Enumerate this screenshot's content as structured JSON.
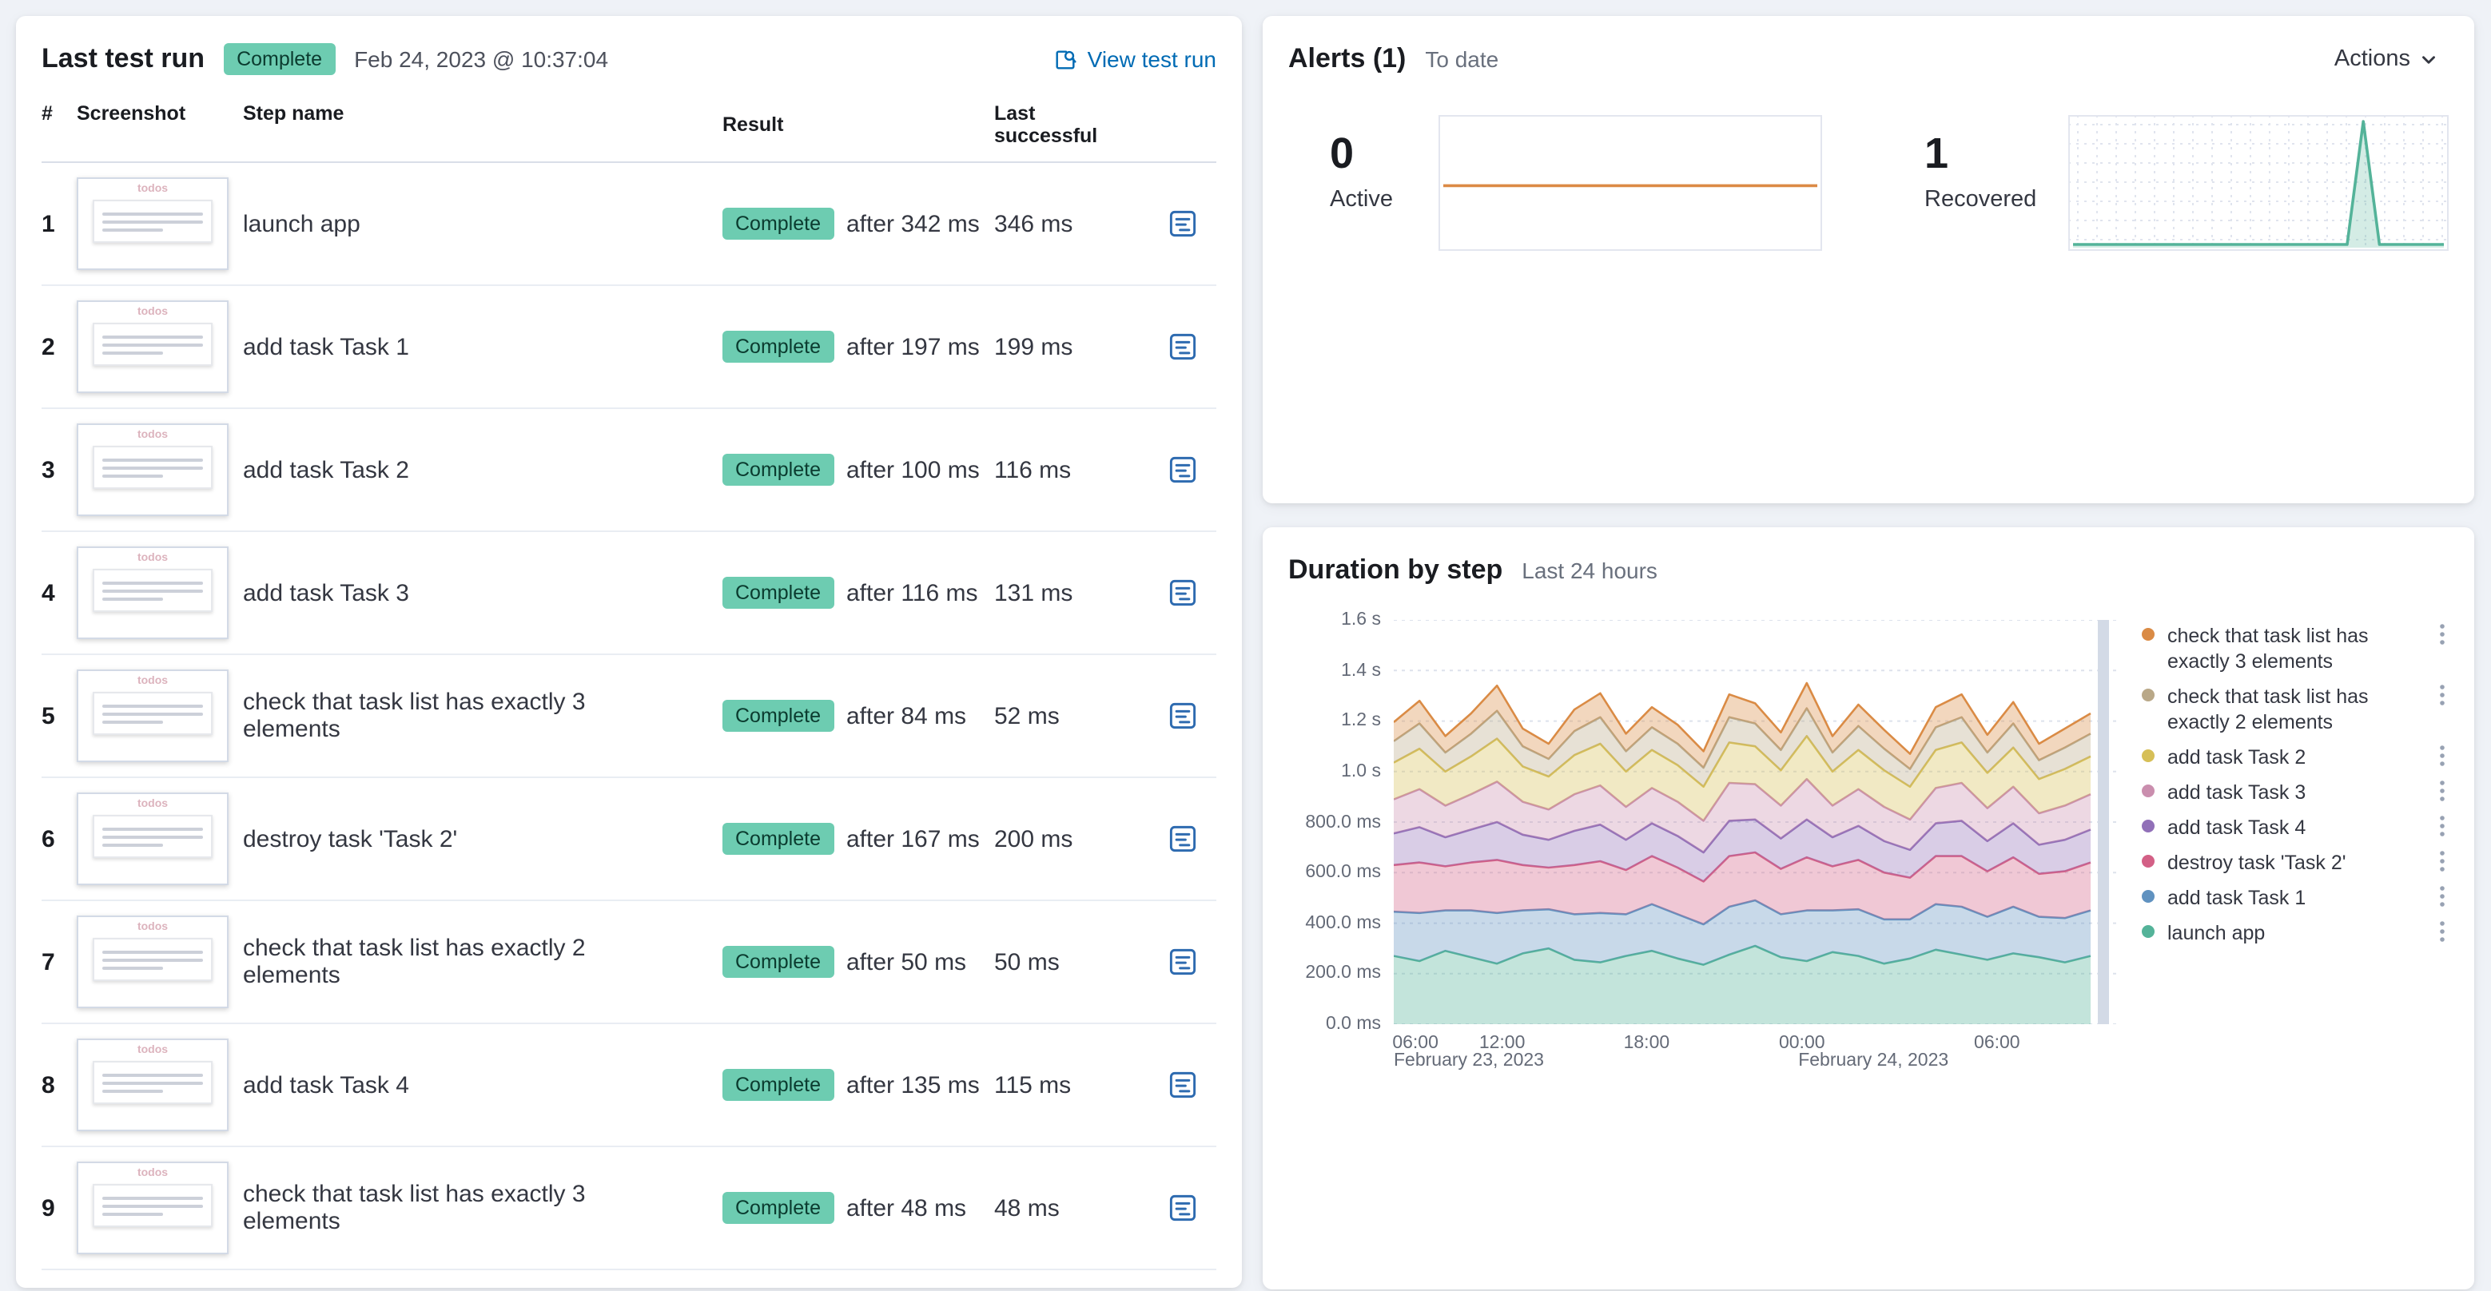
{
  "last_test_run": {
    "title": "Last test run",
    "status_badge": "Complete",
    "timestamp": "Feb 24, 2023 @ 10:37:04",
    "view_test_run_label": "View test run",
    "columns": [
      "#",
      "Screenshot",
      "Step name",
      "Result",
      "Last successful"
    ],
    "thumbnail_label": "todos",
    "steps": [
      {
        "num": "1",
        "name": "launch app",
        "result": "Complete",
        "after": "after 342 ms",
        "last_successful": "346 ms"
      },
      {
        "num": "2",
        "name": "add task Task 1",
        "result": "Complete",
        "after": "after 197 ms",
        "last_successful": "199 ms"
      },
      {
        "num": "3",
        "name": "add task Task 2",
        "result": "Complete",
        "after": "after 100 ms",
        "last_successful": "116 ms"
      },
      {
        "num": "4",
        "name": "add task Task 3",
        "result": "Complete",
        "after": "after 116 ms",
        "last_successful": "131 ms"
      },
      {
        "num": "5",
        "name": "check that task list has exactly 3 elements",
        "result": "Complete",
        "after": "after 84 ms",
        "last_successful": "52 ms"
      },
      {
        "num": "6",
        "name": "destroy task 'Task 2'",
        "result": "Complete",
        "after": "after 167 ms",
        "last_successful": "200 ms"
      },
      {
        "num": "7",
        "name": "check that task list has exactly 2 elements",
        "result": "Complete",
        "after": "after 50 ms",
        "last_successful": "50 ms"
      },
      {
        "num": "8",
        "name": "add task Task 4",
        "result": "Complete",
        "after": "after 135 ms",
        "last_successful": "115 ms"
      },
      {
        "num": "9",
        "name": "check that task list has exactly 3 elements",
        "result": "Complete",
        "after": "after 48 ms",
        "last_successful": "48 ms"
      }
    ]
  },
  "alerts": {
    "title": "Alerts (1)",
    "subtitle": "To date",
    "actions_label": "Actions",
    "active": {
      "count": "0",
      "label": "Active"
    },
    "recovered": {
      "count": "1",
      "label": "Recovered"
    }
  },
  "duration_by_step": {
    "title": "Duration by step",
    "subtitle": "Last 24 hours"
  },
  "chart_data": {
    "duration_by_step": {
      "type": "area",
      "stacked": true,
      "unit": "ms",
      "title": "Duration by step",
      "subtitle": "Last 24 hours",
      "ylim": [
        0,
        1600
      ],
      "grid": true,
      "legend_position": "right",
      "y_tick_labels": [
        "1.6 s",
        "1.4 s",
        "1.2 s",
        "1.0 s",
        "800.0 ms",
        "600.0 ms",
        "400.0 ms",
        "200.0 ms",
        "0.0 ms"
      ],
      "x_ticks": [
        {
          "label": "06:00",
          "pos": 0.03
        },
        {
          "label": "12:00",
          "pos": 0.15
        },
        {
          "label": "18:00",
          "pos": 0.35
        },
        {
          "label": "00:00",
          "pos": 0.565
        },
        {
          "label": "06:00",
          "pos": 0.835
        }
      ],
      "x_date_labels": [
        {
          "label": "February 23, 2023",
          "pos": 0.0
        },
        {
          "label": "February 24, 2023",
          "pos": 0.56
        }
      ],
      "series_bottom_to_top": [
        {
          "name": "launch app",
          "color": "#54B399",
          "values": [
            270,
            250,
            290,
            265,
            240,
            280,
            300,
            255,
            245,
            270,
            290,
            260,
            235,
            275,
            310,
            265,
            250,
            285,
            270,
            240,
            260,
            295,
            275,
            255,
            280,
            265,
            245,
            270
          ]
        },
        {
          "name": "add task Task 1",
          "color": "#6092C0",
          "values": [
            175,
            190,
            160,
            185,
            200,
            170,
            155,
            180,
            195,
            165,
            185,
            175,
            160,
            190,
            180,
            170,
            200,
            165,
            185,
            175,
            155,
            180,
            190,
            170,
            185,
            160,
            175,
            180
          ]
        },
        {
          "name": "destroy task 'Task 2'",
          "color": "#D36086",
          "values": [
            185,
            200,
            175,
            190,
            210,
            180,
            165,
            195,
            205,
            175,
            190,
            185,
            170,
            200,
            190,
            180,
            210,
            175,
            195,
            185,
            165,
            190,
            200,
            180,
            195,
            170,
            185,
            190
          ]
        },
        {
          "name": "add task Task 4",
          "color": "#9170B8",
          "values": [
            125,
            140,
            115,
            130,
            150,
            120,
            110,
            135,
            145,
            120,
            130,
            125,
            115,
            140,
            130,
            120,
            150,
            115,
            135,
            125,
            110,
            130,
            140,
            120,
            135,
            115,
            125,
            130
          ]
        },
        {
          "name": "add task Task 3",
          "color": "#CA8EAE",
          "values": [
            135,
            150,
            125,
            140,
            160,
            130,
            120,
            145,
            155,
            130,
            140,
            135,
            125,
            150,
            140,
            130,
            160,
            125,
            145,
            135,
            120,
            140,
            150,
            130,
            145,
            125,
            135,
            140
          ]
        },
        {
          "name": "add task Task 2",
          "color": "#D6BF57",
          "values": [
            145,
            160,
            135,
            150,
            170,
            140,
            130,
            155,
            165,
            140,
            150,
            145,
            135,
            160,
            150,
            140,
            170,
            135,
            155,
            145,
            130,
            150,
            160,
            140,
            155,
            135,
            145,
            150
          ]
        },
        {
          "name": "check that task list has exactly 2 elements",
          "color": "#B9A888",
          "values": [
            85,
            100,
            75,
            90,
            110,
            80,
            70,
            95,
            105,
            80,
            90,
            85,
            75,
            100,
            90,
            80,
            110,
            75,
            95,
            85,
            70,
            90,
            100,
            80,
            95,
            75,
            85,
            90
          ]
        },
        {
          "name": "check that task list has exactly 3 elements",
          "color": "#DA8B45",
          "values": [
            75,
            90,
            65,
            80,
            100,
            70,
            60,
            85,
            95,
            70,
            80,
            75,
            65,
            90,
            80,
            70,
            100,
            65,
            85,
            75,
            60,
            80,
            90,
            70,
            85,
            65,
            75,
            80
          ]
        }
      ],
      "legend_top_to_bottom": [
        {
          "label": "check that task list has exactly 3 elements",
          "color": "#DA8B45"
        },
        {
          "label": "check that task list has exactly 2 elements",
          "color": "#B9A888"
        },
        {
          "label": "add task Task 2",
          "color": "#D6BF57"
        },
        {
          "label": "add task Task 3",
          "color": "#CA8EAE"
        },
        {
          "label": "add task Task 4",
          "color": "#9170B8"
        },
        {
          "label": "destroy task 'Task 2'",
          "color": "#D36086"
        },
        {
          "label": "add task Task 1",
          "color": "#6092C0"
        },
        {
          "label": "launch app",
          "color": "#54B399"
        }
      ]
    },
    "alerts_active_sparkline": {
      "type": "line",
      "color": "#DC8A45",
      "values": [
        0,
        0,
        0,
        0,
        0,
        0,
        0,
        0,
        0,
        0,
        0,
        0
      ]
    },
    "alerts_recovered_sparkline": {
      "type": "area",
      "color": "#54B399",
      "grid": "dotted",
      "values": [
        0,
        0,
        0,
        0,
        0,
        0,
        0,
        0,
        0,
        0,
        0,
        0,
        0,
        0,
        0,
        0,
        0,
        0,
        1,
        0,
        0,
        0,
        0,
        0
      ]
    }
  }
}
